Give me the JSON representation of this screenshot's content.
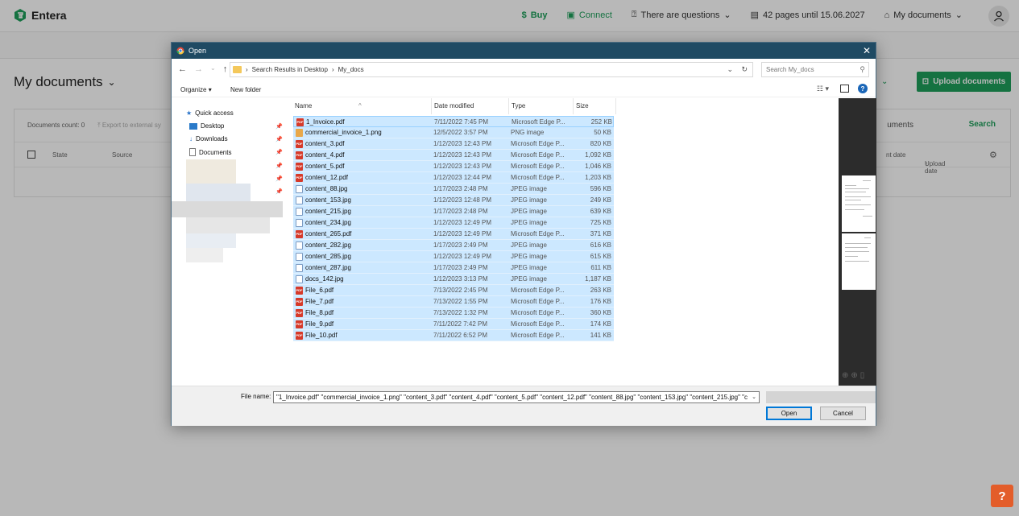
{
  "app": {
    "logo": "Entera",
    "nav": {
      "buy": "Buy",
      "connect": "Connect",
      "questions": "There are questions",
      "pages": "42 pages until 15.06.2027",
      "my_documents": "My documents"
    },
    "page_title": "My documents",
    "upload_button": "Upload documents",
    "documents_count": "Documents count: 0",
    "export_link": "Export to external sy",
    "search_link": "Search",
    "documents_link": "uments",
    "columns": {
      "state": "State",
      "source": "Source",
      "doc_date": "nt date",
      "upload_date": "Upload date"
    },
    "help": "?"
  },
  "dialog": {
    "title": "Open",
    "breadcrumb": [
      "Search Results in Desktop",
      "My_docs"
    ],
    "search_placeholder": "Search My_docs",
    "toolbar": {
      "organize": "Organize",
      "new_folder": "New folder"
    },
    "nav": [
      {
        "label": "Quick access",
        "icon": "star-icon"
      },
      {
        "label": "Desktop",
        "icon": "desktop-icon"
      },
      {
        "label": "Downloads",
        "icon": "download-icon"
      },
      {
        "label": "Documents",
        "icon": "document-icon"
      }
    ],
    "columns": {
      "name": "Name",
      "date": "Date modified",
      "type": "Type",
      "size": "Size"
    },
    "files": [
      {
        "name": "1_Invoice.pdf",
        "date": "7/11/2022 7:45 PM",
        "type": "Microsoft Edge P...",
        "size": "252 KB",
        "kind": "pdf"
      },
      {
        "name": "commercial_invoice_1.png",
        "date": "12/5/2022 3:57 PM",
        "type": "PNG image",
        "size": "50 KB",
        "kind": "png"
      },
      {
        "name": "content_3.pdf",
        "date": "1/12/2023 12:43 PM",
        "type": "Microsoft Edge P...",
        "size": "820 KB",
        "kind": "pdf"
      },
      {
        "name": "content_4.pdf",
        "date": "1/12/2023 12:43 PM",
        "type": "Microsoft Edge P...",
        "size": "1,092 KB",
        "kind": "pdf"
      },
      {
        "name": "content_5.pdf",
        "date": "1/12/2023 12:43 PM",
        "type": "Microsoft Edge P...",
        "size": "1,046 KB",
        "kind": "pdf"
      },
      {
        "name": "content_12.pdf",
        "date": "1/12/2023 12:44 PM",
        "type": "Microsoft Edge P...",
        "size": "1,203 KB",
        "kind": "pdf"
      },
      {
        "name": "content_88.jpg",
        "date": "1/17/2023 2:48 PM",
        "type": "JPEG image",
        "size": "596 KB",
        "kind": "jpg"
      },
      {
        "name": "content_153.jpg",
        "date": "1/12/2023 12:48 PM",
        "type": "JPEG image",
        "size": "249 KB",
        "kind": "jpg"
      },
      {
        "name": "content_215.jpg",
        "date": "1/17/2023 2:48 PM",
        "type": "JPEG image",
        "size": "639 KB",
        "kind": "jpg"
      },
      {
        "name": "content_234.jpg",
        "date": "1/12/2023 12:49 PM",
        "type": "JPEG image",
        "size": "725 KB",
        "kind": "jpg"
      },
      {
        "name": "content_265.pdf",
        "date": "1/12/2023 12:49 PM",
        "type": "Microsoft Edge P...",
        "size": "371 KB",
        "kind": "pdf"
      },
      {
        "name": "content_282.jpg",
        "date": "1/17/2023 2:49 PM",
        "type": "JPEG image",
        "size": "616 KB",
        "kind": "jpg"
      },
      {
        "name": "content_285.jpg",
        "date": "1/12/2023 12:49 PM",
        "type": "JPEG image",
        "size": "615 KB",
        "kind": "jpg"
      },
      {
        "name": "content_287.jpg",
        "date": "1/17/2023 2:49 PM",
        "type": "JPEG image",
        "size": "611 KB",
        "kind": "jpg"
      },
      {
        "name": "docs_142.jpg",
        "date": "1/12/2023 3:13 PM",
        "type": "JPEG image",
        "size": "1,187 KB",
        "kind": "jpg"
      },
      {
        "name": "File_6.pdf",
        "date": "7/13/2022 2:45 PM",
        "type": "Microsoft Edge P...",
        "size": "263 KB",
        "kind": "pdf"
      },
      {
        "name": "File_7.pdf",
        "date": "7/13/2022 1:55 PM",
        "type": "Microsoft Edge P...",
        "size": "176 KB",
        "kind": "pdf"
      },
      {
        "name": "File_8.pdf",
        "date": "7/13/2022 1:32 PM",
        "type": "Microsoft Edge P...",
        "size": "360 KB",
        "kind": "pdf"
      },
      {
        "name": "File_9.pdf",
        "date": "7/11/2022 7:42 PM",
        "type": "Microsoft Edge P...",
        "size": "174 KB",
        "kind": "pdf"
      },
      {
        "name": "File_10.pdf",
        "date": "7/11/2022 6:52 PM",
        "type": "Microsoft Edge P...",
        "size": "141 KB",
        "kind": "pdf"
      }
    ],
    "file_name_label": "File name:",
    "file_name_value": "\"1_Invoice.pdf\" \"commercial_invoice_1.png\" \"content_3.pdf\" \"content_4.pdf\" \"content_5.pdf\" \"content_12.pdf\" \"content_88.jpg\" \"content_153.jpg\" \"content_215.jpg\" \"c",
    "open_button": "Open",
    "cancel_button": "Cancel"
  },
  "colors": {
    "brand": "#1e9e5a",
    "dialog_title_bar": "#1f4a63",
    "selection": "#cce8ff",
    "help_button": "#e35d2a"
  }
}
